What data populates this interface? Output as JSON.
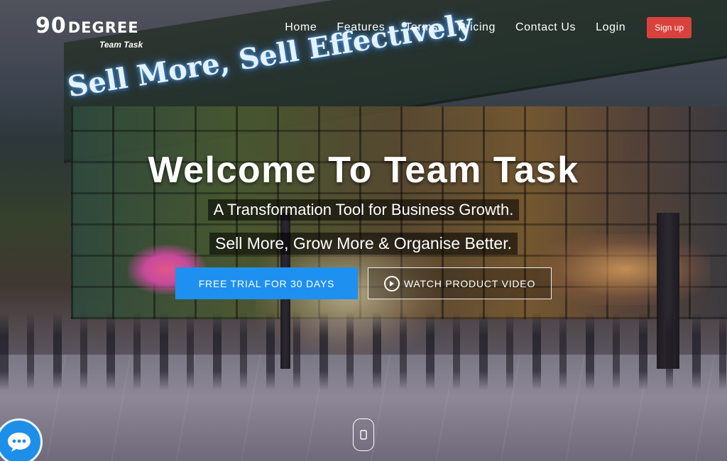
{
  "brand": {
    "number": "90",
    "word": "DEGREE",
    "subtitle": "Team Task"
  },
  "nav": {
    "links": [
      "Home",
      "Features",
      "Terms",
      "Pricing",
      "Contact Us",
      "Login"
    ],
    "signup_label": "Sign up",
    "signup_color": "#d9413c"
  },
  "background": {
    "sign_text": "Sell More, Sell Effectively"
  },
  "hero": {
    "title": "Welcome To Team Task",
    "line1": "A Transformation Tool for Business Growth.",
    "line2": "Sell More, Grow More & Organise Better.",
    "trial_button": "FREE TRIAL FOR 30 DAYS",
    "trial_color": "#1e90f0",
    "video_button": "WATCH PRODUCT VIDEO"
  },
  "icons": {
    "play": "play-circle-icon",
    "scroll": "scroll-down-icon",
    "chat": "chat-bubble-icon"
  }
}
